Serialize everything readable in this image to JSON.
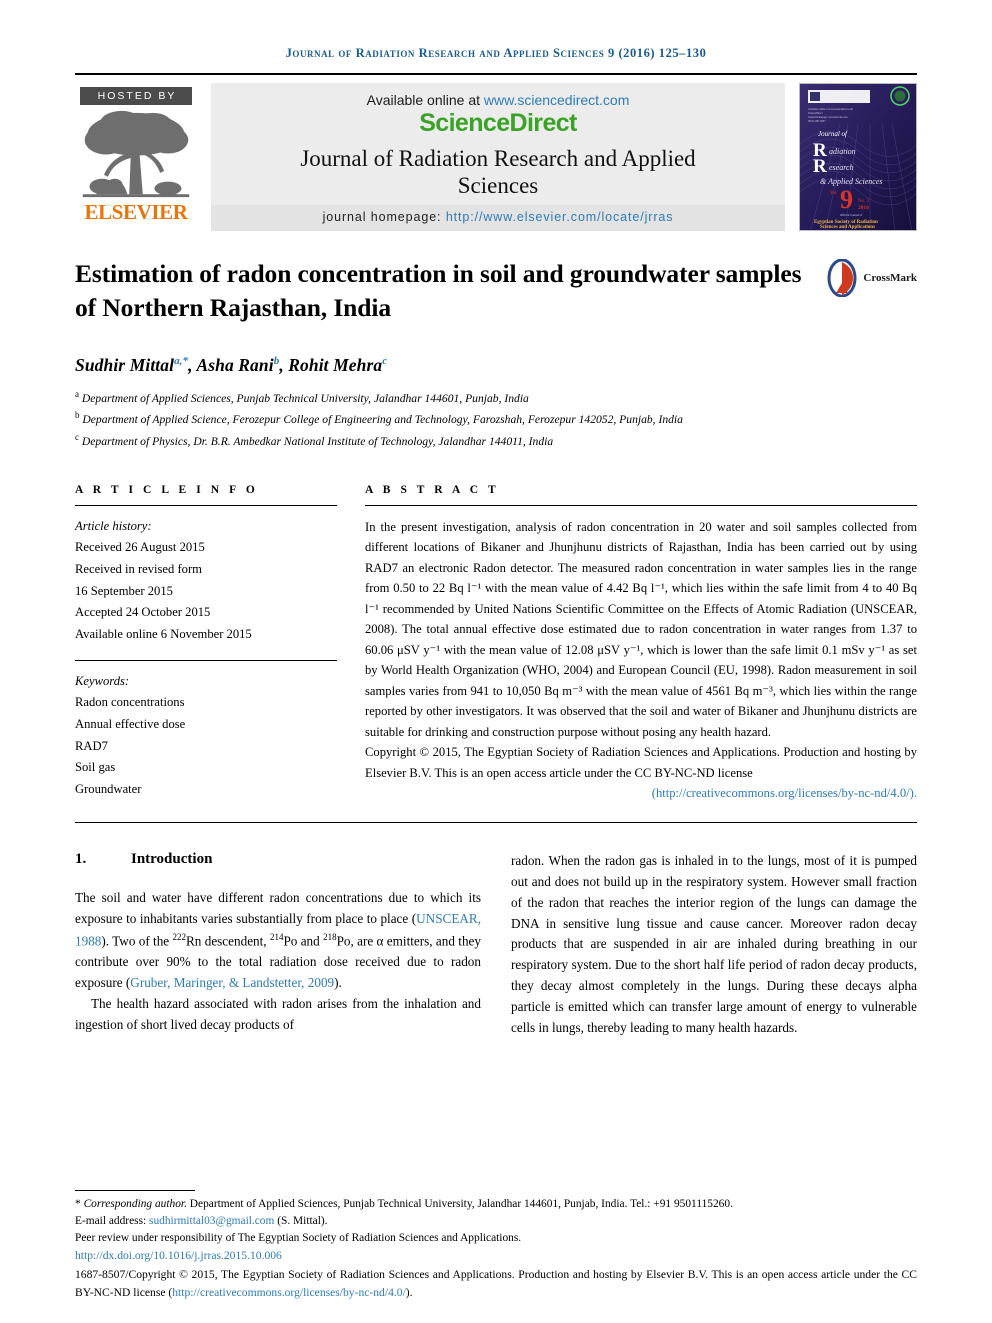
{
  "running_head": "Journal of Radiation Research and Applied Sciences 9 (2016) 125–130",
  "masthead": {
    "hosted_by": "HOSTED BY",
    "publisher": "ELSEVIER",
    "available_prefix": "Available online at ",
    "available_url": "www.sciencedirect.com",
    "sciencedirect_logo": "ScienceDirect",
    "journal_title": "Journal of Radiation Research and Applied Sciences",
    "homepage_label": "journal homepage: ",
    "homepage_url": "http://www.elsevier.com/locate/jrras",
    "cover": {
      "journal_of": "Journal of",
      "line_r": "R",
      "line_r_rest": "adiation",
      "line_res": "R",
      "line_res_rest": "esearch",
      "line_applied": "& Applied Sciences",
      "volume_prefix": "Vol.",
      "volume_number": "9",
      "volume_issue": "No. 2",
      "volume_year": "2016",
      "society_prefix": "Official Journal of",
      "society_line1": "Egyptian Society of Radiation",
      "society_line2": "Sciences and Applications"
    }
  },
  "article": {
    "title": "Estimation of radon concentration in soil and groundwater samples of Northern Rajasthan, India",
    "crossmark_label": "CrossMark",
    "authors": [
      {
        "name": "Sudhir Mittal",
        "marks": "a,*"
      },
      {
        "name": "Asha Rani",
        "marks": "b"
      },
      {
        "name": "Rohit Mehra",
        "marks": "c"
      }
    ],
    "affiliations": [
      {
        "mark": "a",
        "text": "Department of Applied Sciences, Punjab Technical University, Jalandhar 144601, Punjab, India"
      },
      {
        "mark": "b",
        "text": "Department of Applied Science, Ferozepur College of Engineering and Technology, Farozshah, Ferozepur 142052, Punjab, India"
      },
      {
        "mark": "c",
        "text": "Department of Physics, Dr. B.R. Ambedkar National Institute of Technology, Jalandhar 144011, India"
      }
    ]
  },
  "article_info": {
    "heading": "A R T I C L E   I N F O",
    "history_label": "Article history:",
    "history": [
      "Received 26 August 2015",
      "Received in revised form",
      "16 September 2015",
      "Accepted 24 October 2015",
      "Available online 6 November 2015"
    ],
    "keywords_label": "Keywords:",
    "keywords": [
      "Radon concentrations",
      "Annual effective dose",
      "RAD7",
      "Soil gas",
      "Groundwater"
    ]
  },
  "abstract": {
    "heading": "A B S T R A C T",
    "text": "In the present investigation, analysis of radon concentration in 20 water and soil samples collected from different locations of Bikaner and Jhunjhunu districts of Rajasthan, India has been carried out by using RAD7 an electronic Radon detector. The measured radon concentration in water samples lies in the range from 0.50 to 22 Bq l⁻¹ with the mean value of 4.42 Bq l⁻¹, which lies within the safe limit from 4 to 40 Bq l⁻¹ recommended by United Nations Scientific Committee on the Effects of Atomic Radiation (UNSCEAR, 2008). The total annual effective dose estimated due to radon concentration in water ranges from 1.37 to 60.06 μSV y⁻¹ with the mean value of 12.08 μSV y⁻¹, which is lower than the safe limit 0.1 mSv y⁻¹ as set by World Health Organization (WHO, 2004) and European Council (EU, 1998). Radon measurement in soil samples varies from 941 to 10,050 Bq m⁻³ with the mean value of 4561 Bq m⁻³, which lies within the range reported by other investigators. It was observed that the soil and water of Bikaner and Jhunjhunu districts are suitable for drinking and construction purpose without posing any health hazard.",
    "copyright": "Copyright © 2015, The Egyptian Society of Radiation Sciences and Applications. Production and hosting by Elsevier B.V. This is an open access article under the CC BY-NC-ND license",
    "license_url": "(http://creativecommons.org/licenses/by-nc-nd/4.0/)."
  },
  "introduction": {
    "number": "1.",
    "heading": "Introduction",
    "left_p1_a": "The soil and water have different radon concentrations due to which its exposure to inhabitants varies substantially from place to place (",
    "left_p1_cite1": "UNSCEAR, 1988",
    "left_p1_b": "). Two of the ",
    "left_p1_sup1": "222",
    "left_p1_c": "Rn descendent, ",
    "left_p1_sup2": "214",
    "left_p1_d": "Po and ",
    "left_p1_sup3": "218",
    "left_p1_e": "Po, are α emitters, and they contribute over 90% to the total radiation dose received due to radon exposure (",
    "left_p1_cite2": "Gruber, Maringer, & Landstetter, 2009",
    "left_p1_f": ").",
    "left_p2": "The health hazard associated with radon arises from the inhalation and ingestion of short lived decay products of",
    "right_p1": "radon. When the radon gas is inhaled in to the lungs, most of it is pumped out and does not build up in the respiratory system. However small fraction of the radon that reaches the interior region of the lungs can damage the DNA in sensitive lung tissue and cause cancer. Moreover radon decay products that are suspended in air are inhaled during breathing in our respiratory system. Due to the short half life period of radon decay products, they decay almost completely in the lungs. During these decays alpha particle is emitted which can transfer large amount of energy to vulnerable cells in lungs, thereby leading to many health hazards."
  },
  "footnotes": {
    "corresponding_mark": "*",
    "corresponding_label": "Corresponding author.",
    "corresponding_text": " Department of Applied Sciences, Punjab Technical University, Jalandhar 144601, Punjab, India. Tel.: +91 9501115260.",
    "email_label": "E-mail address: ",
    "email": "sudhirmittal03@gmail.com",
    "email_suffix": " (S. Mittal).",
    "peer_review": "Peer review under responsibility of The Egyptian Society of Radiation Sciences and Applications.",
    "doi": "http://dx.doi.org/10.1016/j.jrras.2015.10.006",
    "final_copyright_a": "1687-8507/Copyright © 2015, The Egyptian Society of Radiation Sciences and Applications. Production and hosting by Elsevier B.V. This is an open access article under the CC BY-NC-ND license (",
    "final_copyright_url": "http://creativecommons.org/licenses/by-nc-nd/4.0/",
    "final_copyright_b": ")."
  },
  "colors": {
    "journal_blue": "#1a5a8e",
    "link_blue": "#2e7bb5",
    "elsevier_orange": "#e8740c",
    "sciencedirect_green": "#3aa226",
    "cover_purple": "#2b2060",
    "crossmark_red": "#d43c1e"
  }
}
